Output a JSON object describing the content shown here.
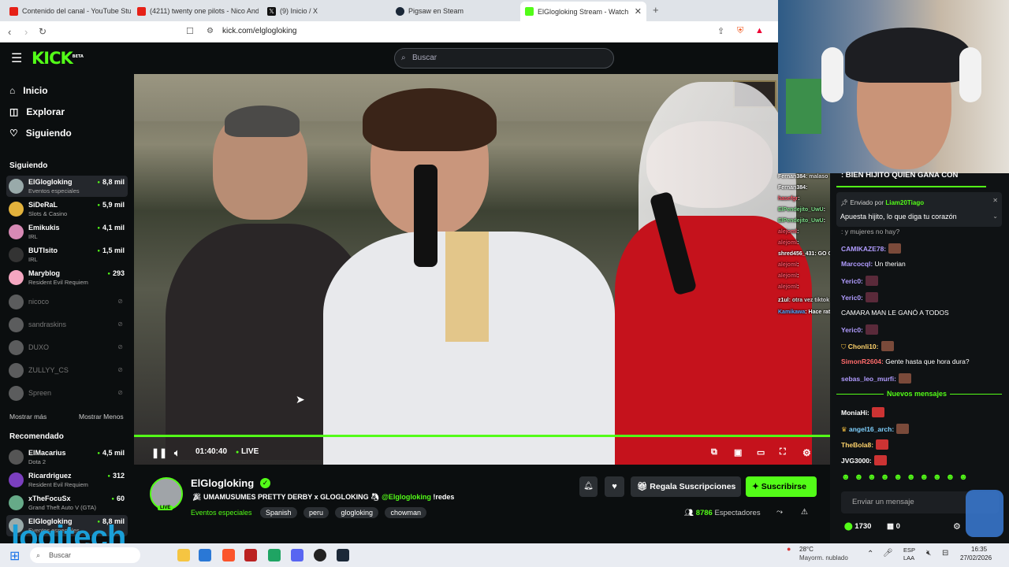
{
  "browser": {
    "tabs": [
      {
        "title": "Contenido del canal - YouTube Studi",
        "color": "#e62117"
      },
      {
        "title": "(4211) twenty one pilots - Nico And",
        "color": "#e62117"
      },
      {
        "title": "(9) Inicio / X",
        "color": "#111111"
      },
      {
        "title": "Pigsaw en Steam",
        "color": "#1b2838"
      },
      {
        "title": "ElGlogloking Stream - Watch",
        "color": "#53fc18"
      }
    ],
    "url": "kick.com/elglogloking"
  },
  "header": {
    "logo": "KICK",
    "logo_badge": "BETA",
    "search_placeholder": "Buscar"
  },
  "sidebar": {
    "nav": [
      {
        "label": "Inicio",
        "icon": "home-icon"
      },
      {
        "label": "Explorar",
        "icon": "compass-icon"
      },
      {
        "label": "Siguiendo",
        "icon": "heart-icon"
      }
    ],
    "following_title": "Siguiendo",
    "following": [
      {
        "name": "ElGlogloking",
        "category": "Eventos especiales",
        "viewers": "8,8 mil"
      },
      {
        "name": "SiDeRaL",
        "category": "Slots & Casino",
        "viewers": "5,9 mil"
      },
      {
        "name": "Emikukis",
        "category": "IRL",
        "viewers": "4,1 mil"
      },
      {
        "name": "BUTIsito",
        "category": "IRL",
        "viewers": "1,5 mil"
      },
      {
        "name": "Maryblog",
        "category": "Resident Evil Requiem",
        "viewers": "293"
      }
    ],
    "offline": [
      "nicoco",
      "sandraskins",
      "DUXO",
      "ZULLYY_CS",
      "Spreen"
    ],
    "show_more": "Mostrar más",
    "show_less": "Mostrar Menos",
    "recommended_title": "Recomendado",
    "recommended": [
      {
        "name": "ElMacarius",
        "category": "Dota 2",
        "viewers": "4,5 mil"
      },
      {
        "name": "Ricardriguez",
        "category": "Resident Evil Requiem",
        "viewers": "312"
      },
      {
        "name": "xTheFocuSx",
        "category": "Grand Theft Auto V (GTA)",
        "viewers": "60"
      },
      {
        "name": "ElGlogloking",
        "category": "Eventos especiales",
        "viewers": "8,8 mil"
      }
    ]
  },
  "player": {
    "time": "01:40:40",
    "live_label": "LIVE",
    "progress_fraction": 1.0
  },
  "stream": {
    "channel": "ElGlogloking",
    "live_badge": "LIVE",
    "title": "UMAMUSUMES PRETTY DERBY x GLOGLOKING",
    "mention": "@Elglogloking",
    "command": "!redes",
    "category": "Eventos especiales",
    "tags": [
      "Spanish",
      "peru",
      "glogloking",
      "chowman"
    ],
    "viewers": "8786",
    "viewers_label": "Espectadores",
    "gift_button": "Regala Suscripciones",
    "subscribe_button": "Suscribirse"
  },
  "chat": {
    "pinned_header": ": BIEN HIJITO QUIEN GANA CON",
    "pinned_sent_by": "Enviado por",
    "pinned_user": "Liam20Tiago",
    "pinned_text": "Apuesta hijito, lo que diga tu corazón",
    "partial_line": ": y mujeres no hay?",
    "messages": [
      {
        "user": "CAMIKAZE78:",
        "text": "",
        "color": "#b19cff"
      },
      {
        "user": "Marcocql:",
        "text": "Un therian",
        "color": "#b19cff"
      },
      {
        "user": "Yeric0:",
        "text": "",
        "color": "#b19cff"
      },
      {
        "user": "Yeric0:",
        "text": "",
        "color": "#b19cff"
      },
      {
        "user": "",
        "text": "CAMARA MAN LE GANÓ A TODOS",
        "color": "#b19cff"
      },
      {
        "user": "Yeric0:",
        "text": "",
        "color": "#b19cff"
      },
      {
        "user": "Chonli10:",
        "text": "",
        "color": "#ffd36b"
      },
      {
        "user": "SimonR2604:",
        "text": "Gente hasta que hora dura?",
        "color": "#ff6b6b"
      },
      {
        "user": "sebas_leo_murfi:",
        "text": "",
        "color": "#b19cff"
      }
    ],
    "new_messages": "Nuevos mensajes",
    "messages_after": [
      {
        "user": "MoniaHi:",
        "text": "",
        "color": "#ffffff"
      },
      {
        "user": "angel16_arch:",
        "text": "",
        "color": "#7fd1ff"
      },
      {
        "user": "TheBola8:",
        "text": "",
        "color": "#ffd36b"
      },
      {
        "user": "JVG3000:",
        "text": "",
        "color": "#ffffff"
      }
    ],
    "input_placeholder": "Enviar un mensaje",
    "points": "1730",
    "gift_count": "0"
  },
  "overlay_chat": [
    {
      "user": "Fernan384",
      "text": ": malaso"
    },
    {
      "user": "Fernan384",
      "text": ":"
    },
    {
      "user": "hasefgr",
      "text": ":"
    },
    {
      "user": "ElPendejito_UwU",
      "text": ":"
    },
    {
      "user": "ElPendejito_UwU",
      "text": ":"
    },
    {
      "user": "alejoml",
      "text": ":"
    },
    {
      "user": "alejoml",
      "text": ":"
    },
    {
      "user": "shred456_431",
      "text": ": GO GOTY MIERDA"
    },
    {
      "user": "alejoml",
      "text": ":"
    },
    {
      "user": "alejoml",
      "text": ":"
    },
    {
      "user": "alejoml",
      "text": ":"
    },
    {
      "user": "z1ul",
      "text": ": otra vez tiktok"
    },
    {
      "user": "Kamikawa",
      "text": ": Hace rato creo"
    }
  ],
  "taskbar": {
    "search": "Buscar",
    "weather_temp": "28°C",
    "weather_desc": "Mayorm. nublado",
    "lang_1": "ESP",
    "lang_2": "LAA",
    "time": "16:35",
    "date": "27/02/2026"
  },
  "watermark": "logitech"
}
